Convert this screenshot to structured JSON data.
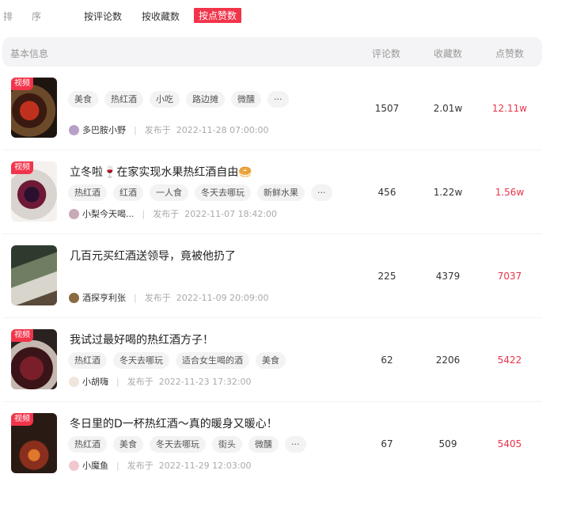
{
  "sortbar": {
    "label": "排  序",
    "label_a": "排",
    "label_b": "序",
    "options": [
      "按评论数",
      "按收藏数",
      "按点赞数"
    ],
    "active_index": 2
  },
  "table": {
    "headers": {
      "info": "基本信息",
      "comments": "评论数",
      "favorites": "收藏数",
      "likes": "点赞数"
    }
  },
  "colors": {
    "accent": "#f2344a",
    "likes_text": "#e8334a"
  },
  "rows": [
    {
      "badge": "视频",
      "title": "",
      "tags": [
        "美食",
        "热红酒",
        "小吃",
        "路边摊",
        "微醺",
        "···"
      ],
      "author": "多巴胺小野",
      "pub_prefix": "发布于",
      "pub_time": "2022-11-28 07:00:00",
      "comments": "1507",
      "favorites": "2.01w",
      "likes": "12.11w"
    },
    {
      "badge": "视频",
      "title": "立冬啦🍷在家实现水果热红酒自由🥯",
      "tags": [
        "热红酒",
        "红酒",
        "一人食",
        "冬天去哪玩",
        "新鲜水果",
        "···"
      ],
      "author": "小梨今天喝...",
      "pub_prefix": "发布于",
      "pub_time": "2022-11-07 18:42:00",
      "comments": "456",
      "favorites": "1.22w",
      "likes": "1.56w"
    },
    {
      "badge": "",
      "title": "几百元买红酒送领导，竟被他扔了",
      "tags": [],
      "author": "酒探亨利张",
      "pub_prefix": "发布于",
      "pub_time": "2022-11-09 20:09:00",
      "comments": "225",
      "favorites": "4379",
      "likes": "7037"
    },
    {
      "badge": "视频",
      "title": "我试过最好喝的热红酒方子！",
      "tags": [
        "热红酒",
        "冬天去哪玩",
        "适合女生喝的酒",
        "美食"
      ],
      "author": "小胡嗨",
      "pub_prefix": "发布于",
      "pub_time": "2022-11-23 17:32:00",
      "comments": "62",
      "favorites": "2206",
      "likes": "5422"
    },
    {
      "badge": "视频",
      "title": "冬日里的D一杯热红酒～真的暖身又暖心！",
      "tags": [
        "热红酒",
        "美食",
        "冬天去哪玩",
        "街头",
        "微醺",
        "···"
      ],
      "author": "小魔鱼",
      "pub_prefix": "发布于",
      "pub_time": "2022-11-29 12:03:00",
      "comments": "67",
      "favorites": "509",
      "likes": "5405"
    }
  ]
}
